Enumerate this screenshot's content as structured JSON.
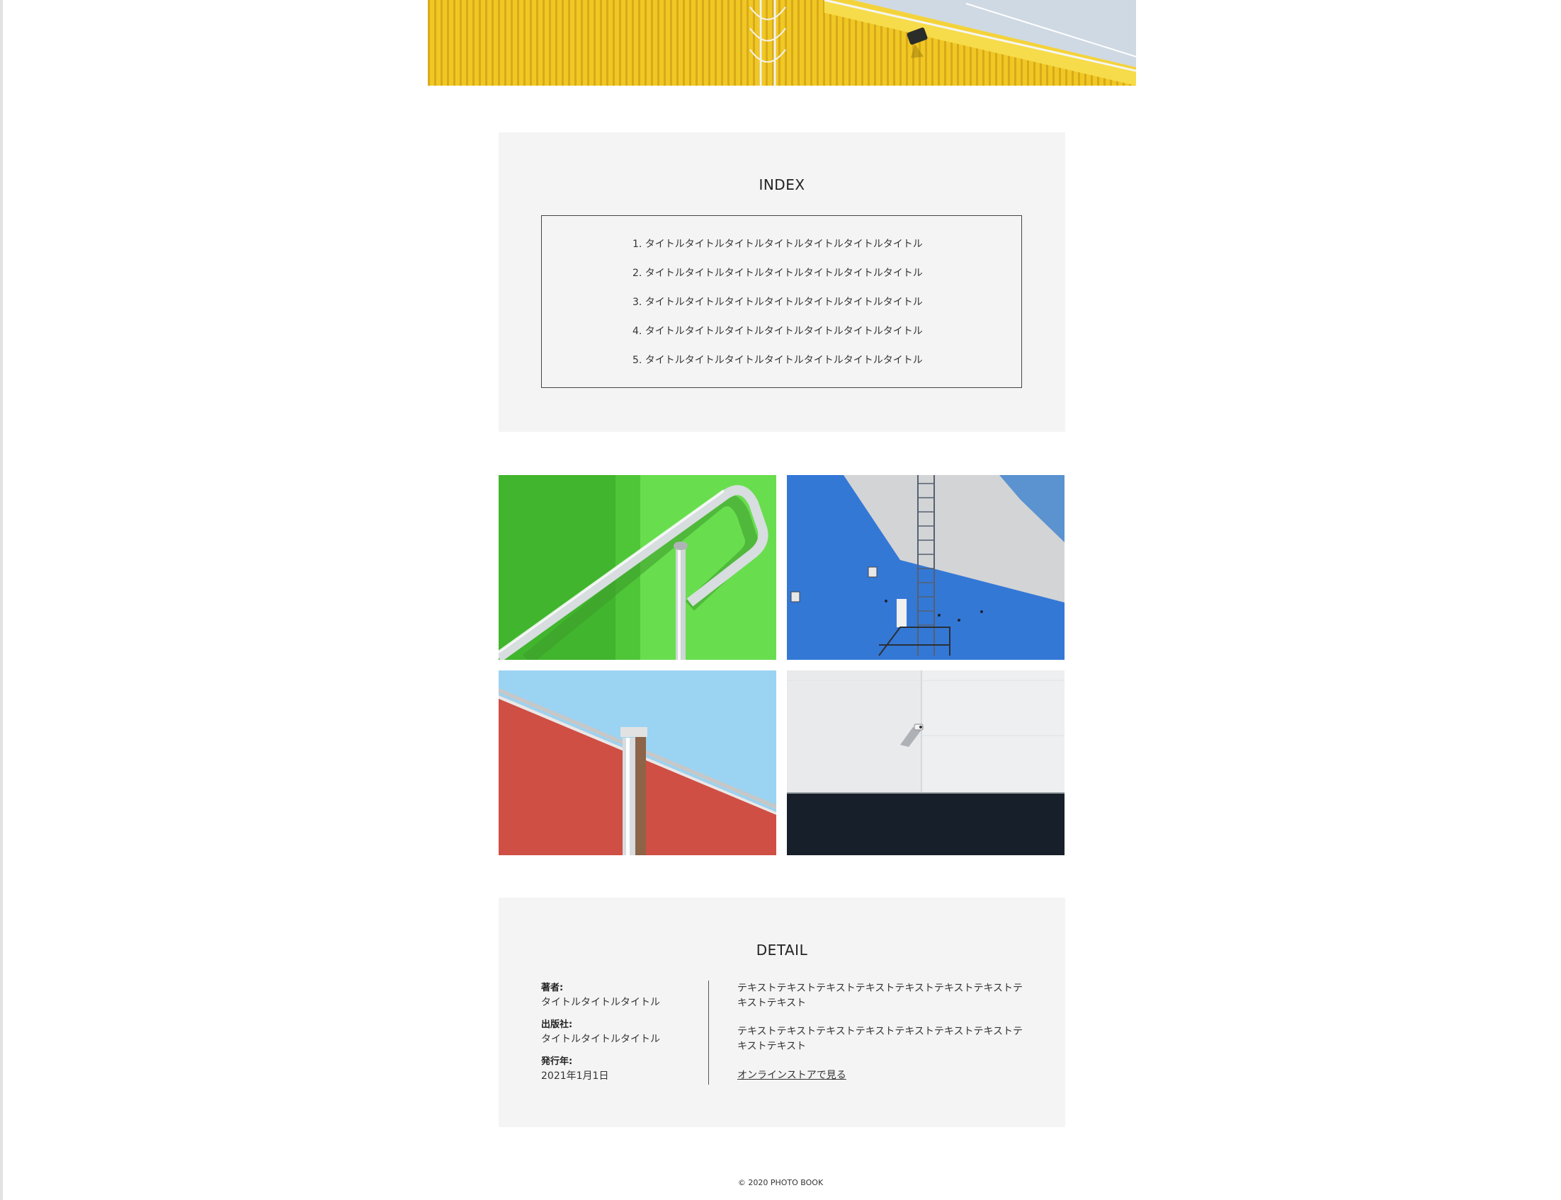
{
  "index": {
    "title": "INDEX",
    "items": [
      "1. タイトルタイトルタイトルタイトルタイトルタイトルタイトル",
      "2. タイトルタイトルタイトルタイトルタイトルタイトルタイトル",
      "3. タイトルタイトルタイトルタイトルタイトルタイトルタイトル",
      "4. タイトルタイトルタイトルタイトルタイトルタイトルタイトル",
      "5. タイトルタイトルタイトルタイトルタイトルタイトルタイトル"
    ]
  },
  "photos": [
    {
      "name": "yellow-building-photo",
      "color": "#f2cf2a"
    },
    {
      "name": "green-wall-railing-photo",
      "color": "#64d94a"
    },
    {
      "name": "blue-wall-ladder-photo",
      "color": "#3a7ad8"
    },
    {
      "name": "red-wall-pipe-photo",
      "color": "#cf4f44"
    },
    {
      "name": "white-wall-camera-photo",
      "color": "#17202a"
    }
  ],
  "detail": {
    "title": "DETAIL",
    "author_label": "著者:",
    "author_value": "タイトルタイトルタイトル",
    "publisher_label": "出版社:",
    "publisher_value": "タイトルタイトルタイトル",
    "year_label": "発行年:",
    "year_value": "2021年1月1日",
    "paragraph1": "テキストテキストテキストテキストテキストテキストテキストテキストテキスト",
    "paragraph2": "テキストテキストテキストテキストテキストテキストテキストテキストテキスト",
    "store_link": "オンラインストアで見る"
  },
  "footer": {
    "copyright": "© 2020 PHOTO BOOK"
  }
}
